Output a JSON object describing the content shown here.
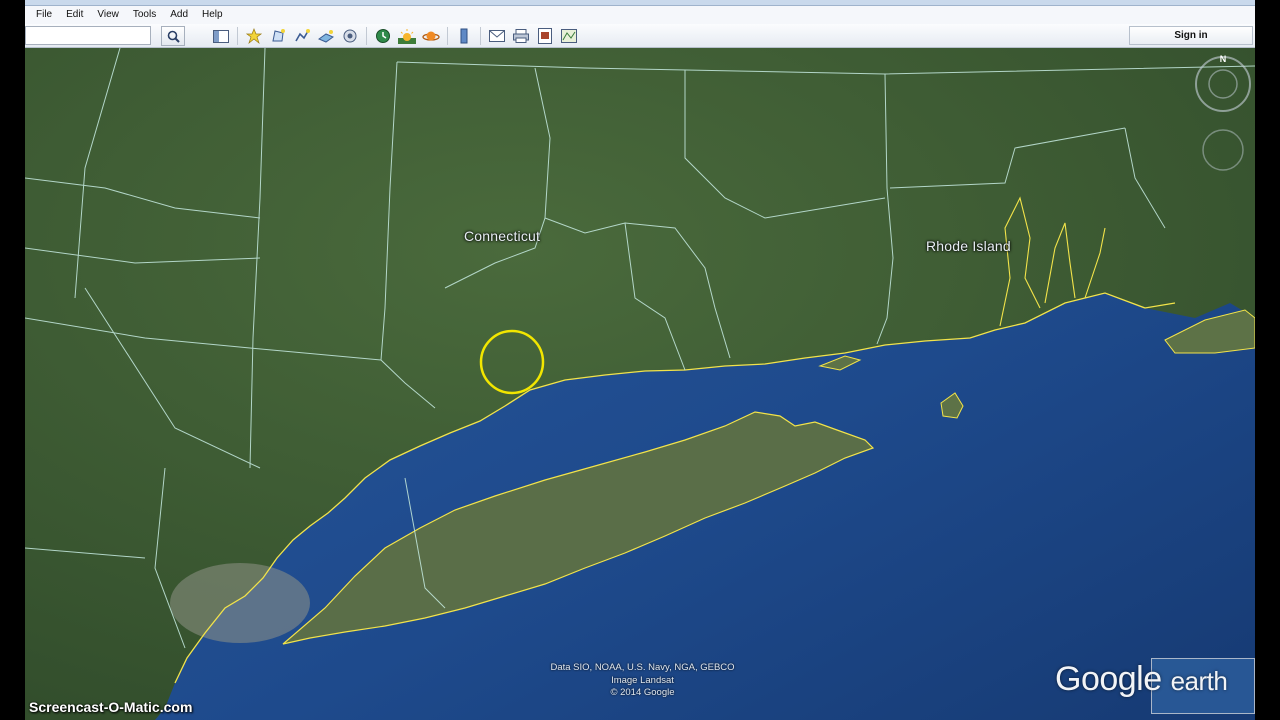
{
  "window": {
    "title": "Google Earth"
  },
  "menu": [
    {
      "label": "File"
    },
    {
      "label": "Edit"
    },
    {
      "label": "View"
    },
    {
      "label": "Tools"
    },
    {
      "label": "Add"
    },
    {
      "label": "Help"
    }
  ],
  "toolbar": {
    "search_value": "",
    "signin_label": "Sign in",
    "tools": [
      {
        "icon": "sidebar-icon"
      },
      {
        "icon": "placemark-icon"
      },
      {
        "icon": "polygon-icon"
      },
      {
        "icon": "path-icon"
      },
      {
        "icon": "image-overlay-icon"
      },
      {
        "icon": "record-tour-icon"
      },
      {
        "icon": "historical-imagery-icon"
      },
      {
        "icon": "sunlight-icon"
      },
      {
        "icon": "planets-icon"
      },
      {
        "icon": "ruler-icon"
      },
      {
        "icon": "email-icon"
      },
      {
        "icon": "print-icon"
      },
      {
        "icon": "save-image-icon"
      },
      {
        "icon": "view-in-maps-icon"
      }
    ]
  },
  "map": {
    "labels": {
      "connecticut": "Connecticut",
      "rhode_island": "Rhode Island"
    },
    "attribution": {
      "line1": "Data SIO, NOAA, U.S. Navy, NGA, GEBCO",
      "line2": "Image Landsat",
      "line3": "© 2014 Google"
    },
    "logo": {
      "google": "Google",
      "earth": "earth"
    },
    "compass": "N",
    "colors": {
      "land": "#3d5a33",
      "water": "#1f4c8e",
      "coastline": "#f2e34a",
      "borders": "#bfe3d8",
      "highlight_circle": "#f2e600"
    }
  },
  "watermark": "Screencast-O-Matic.com"
}
